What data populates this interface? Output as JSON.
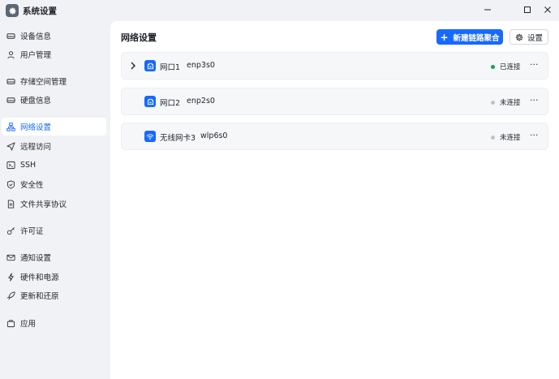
{
  "window": {
    "title": "系统设置",
    "controls": [
      "minimize",
      "maximize",
      "close"
    ]
  },
  "sidebar": {
    "items": [
      {
        "label": "设备信息",
        "icon": "device-icon",
        "active": false
      },
      {
        "label": "用户管理",
        "icon": "user-icon",
        "active": false
      },
      {
        "label": "存储空间管理",
        "icon": "storage-icon",
        "active": false
      },
      {
        "label": "硬盘信息",
        "icon": "disk-icon",
        "active": false
      },
      {
        "label": "网络设置",
        "icon": "network-icon",
        "active": true
      },
      {
        "label": "远程访问",
        "icon": "send-icon",
        "active": false
      },
      {
        "label": "SSH",
        "icon": "terminal-icon",
        "active": false
      },
      {
        "label": "安全性",
        "icon": "shield-icon",
        "active": false
      },
      {
        "label": "文件共享协议",
        "icon": "file-icon",
        "active": false
      },
      {
        "label": "许可证",
        "icon": "key-icon",
        "active": false
      },
      {
        "label": "通知设置",
        "icon": "mail-icon",
        "active": false
      },
      {
        "label": "硬件和电源",
        "icon": "power-icon",
        "active": false
      },
      {
        "label": "更新和还原",
        "icon": "rocket-icon",
        "active": false
      },
      {
        "label": "应用",
        "icon": "apps-icon",
        "active": false
      }
    ]
  },
  "main": {
    "title": "网络设置",
    "new_bond_label": "新建链路聚合",
    "settings_label": "设置",
    "interfaces": [
      {
        "name": "网口1",
        "device": "enp3s0",
        "status": "已连接",
        "status_color": "#12a05c",
        "type": "ethernet",
        "expandable": true
      },
      {
        "name": "网口2",
        "device": "enp2s0",
        "status": "未连接",
        "status_color": "#bfc3ca",
        "type": "ethernet",
        "expandable": false
      },
      {
        "name": "无线网卡3",
        "device": "wlp6s0",
        "status": "未连接",
        "status_color": "#bfc3ca",
        "type": "wifi",
        "expandable": false
      }
    ]
  },
  "colors": {
    "accent": "#1769ff",
    "background": "#f1f2f5",
    "card": "#f6f7f9"
  }
}
